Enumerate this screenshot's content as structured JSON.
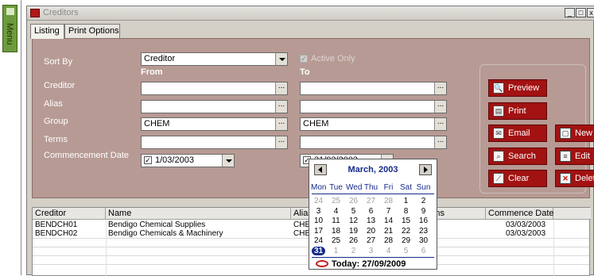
{
  "menu": {
    "label": "Menu"
  },
  "window": {
    "title": "Creditors",
    "controls": {
      "minimize": "_",
      "restore": "□",
      "close": "x"
    }
  },
  "tabs": [
    {
      "label": "Listing",
      "active": true
    },
    {
      "label": "Print Options",
      "active": false
    }
  ],
  "filters": {
    "sort_by_label": "Sort By",
    "sort_by_value": "Creditor",
    "active_only_label": "Active Only",
    "active_only_checked": true,
    "from_header": "From",
    "to_header": "To",
    "creditor_label": "Creditor",
    "creditor_from": "",
    "creditor_to": "",
    "alias_label": "Alias",
    "alias_from": "",
    "alias_to": "",
    "group_label": "Group",
    "group_from": "CHEM",
    "group_to": "CHEM",
    "terms_label": "Terms",
    "terms_from": "",
    "terms_to": "",
    "commencement_label": "Commencement Date",
    "commencement_from": "1/03/2003",
    "commencement_to": "31/03/2003",
    "ellipsis": "..."
  },
  "buttons": {
    "preview": "Preview",
    "print": "Print",
    "email": "Email",
    "search": "Search",
    "clear": "Clear",
    "new": "New",
    "edit": "Edit",
    "delete": "Delete"
  },
  "grid": {
    "headers": [
      "Creditor",
      "Name",
      "Alias",
      "Terms",
      "Commence Date"
    ],
    "rows": [
      {
        "creditor": "BENDCH01",
        "name": "Bendigo Chemical Supplies",
        "alias": "CHE",
        "commence": "03/03/2003"
      },
      {
        "creditor": "BENDCH02",
        "name": "Bendigo Chemicals & Machinery",
        "alias": "CHE",
        "commence": "03/03/2003"
      }
    ]
  },
  "calendar": {
    "title": "March, 2003",
    "days_of_week": [
      "Mon",
      "Tue",
      "Wed",
      "Thu",
      "Fri",
      "Sat",
      "Sun"
    ],
    "weeks": [
      [
        "24",
        "25",
        "26",
        "27",
        "28",
        "1",
        "2"
      ],
      [
        "3",
        "4",
        "5",
        "6",
        "7",
        "8",
        "9"
      ],
      [
        "10",
        "11",
        "12",
        "13",
        "14",
        "15",
        "16"
      ],
      [
        "17",
        "18",
        "19",
        "20",
        "21",
        "22",
        "23"
      ],
      [
        "24",
        "25",
        "26",
        "27",
        "28",
        "29",
        "30"
      ],
      [
        "31",
        "1",
        "2",
        "3",
        "4",
        "5",
        "6"
      ]
    ],
    "selected_day": "31",
    "today_label": "Today: 27/09/2009"
  },
  "colors": {
    "panel": "#b79a94",
    "button_red": "#a21212",
    "calendar_blue": "#152b8a",
    "today_ring": "#c81414"
  }
}
